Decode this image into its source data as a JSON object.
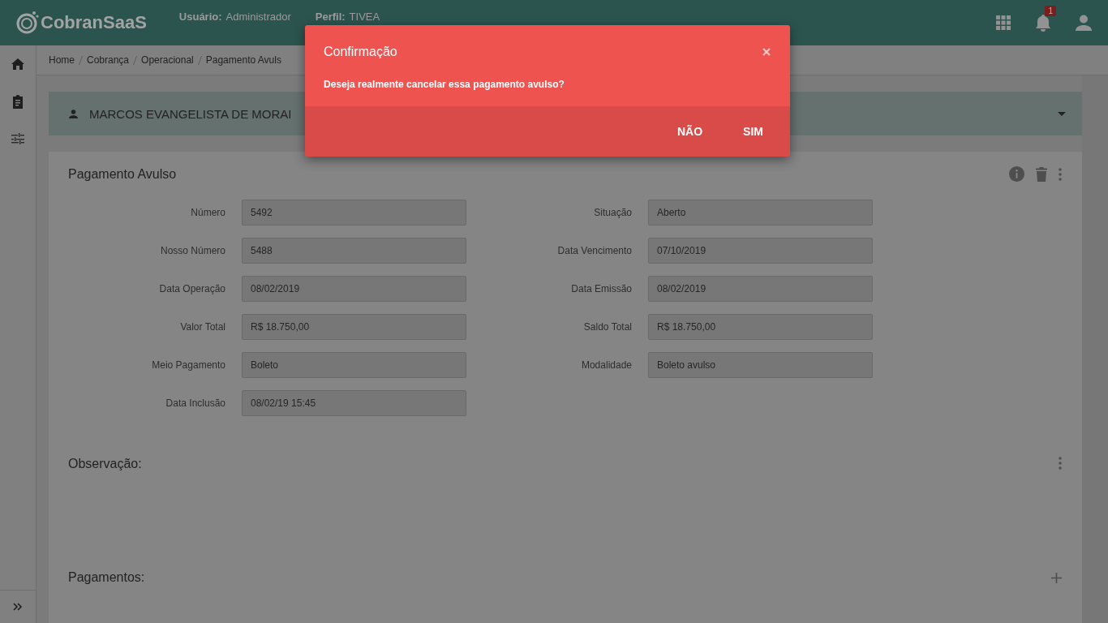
{
  "header": {
    "logo": "CobranSaaS",
    "user_label": "Usuário:",
    "user": "Administrador",
    "profile_label": "Perfil:",
    "profile": "TIVEA",
    "notification_count": "1"
  },
  "breadcrumb": [
    "Home",
    "Cobrança",
    "Operacional",
    "Pagamento Avuls"
  ],
  "customer": {
    "name": "MARCOS EVANGELISTA DE MORAI"
  },
  "card": {
    "title": "Pagamento Avulso",
    "fields_left": [
      {
        "label": "Número",
        "value": "5492"
      },
      {
        "label": "Nosso Número",
        "value": "5488"
      },
      {
        "label": "Data Operação",
        "value": "08/02/2019"
      },
      {
        "label": "Valor Total",
        "value": "R$ 18.750,00"
      },
      {
        "label": "Meio Pagamento",
        "value": "Boleto"
      },
      {
        "label": "Data Inclusão",
        "value": "08/02/19 15:45"
      }
    ],
    "fields_right": [
      {
        "label": "Situação",
        "value": "Aberto"
      },
      {
        "label": "Data Vencimento",
        "value": "07/10/2019"
      },
      {
        "label": "Data Emissão",
        "value": "08/02/2019"
      },
      {
        "label": "Saldo Total",
        "value": "R$ 18.750,00"
      },
      {
        "label": "Modalidade",
        "value": "Boleto avulso"
      }
    ]
  },
  "sections": [
    {
      "title": "Observação:",
      "kind": "menu"
    },
    {
      "title": "Pagamentos:",
      "kind": "add"
    }
  ],
  "dialog": {
    "title": "Confirmação",
    "message": "Deseja realmente cancelar essa pagamento avulso?",
    "buttons": [
      "NÃO",
      "SIM"
    ]
  }
}
